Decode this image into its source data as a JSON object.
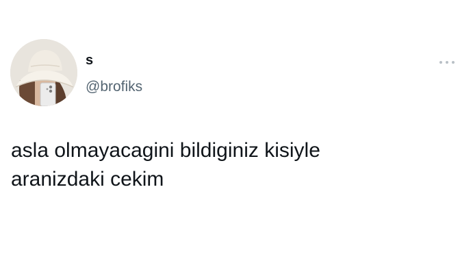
{
  "tweet": {
    "author": {
      "display_name": "s",
      "handle": "@brofiks",
      "avatar_icon": "bucket-hat-person-avatar"
    },
    "more_icon": "more-options-icon",
    "text": "asla olmayacagini bildiginiz kisiyle\naranizdaki cekim",
    "colors": {
      "background": "#ffffff",
      "text": "#0f1419",
      "secondary_text": "#536471",
      "more_dots": "#b9c0c6"
    }
  }
}
